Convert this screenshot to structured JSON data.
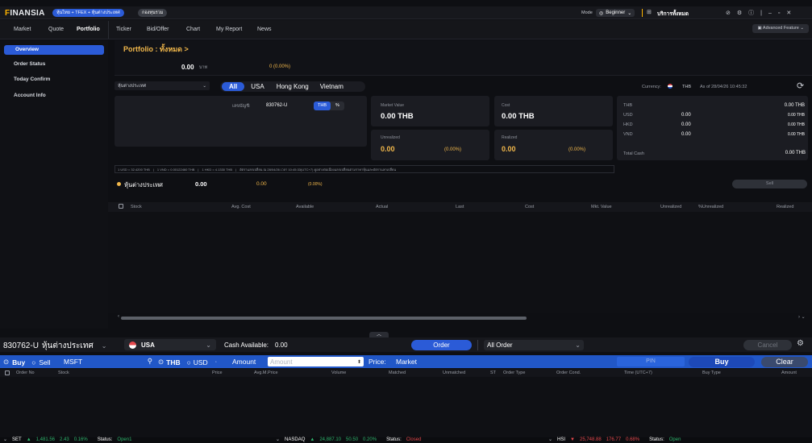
{
  "app": {
    "logo": "INANSIA",
    "logo_mark": "F",
    "tab1": "หุ้นไทย + TFEX + หุ้นต่างประเทศ",
    "tab2": "กองทุนรวม",
    "mode_label": "Mode",
    "mode_value": "Beginner",
    "services": "บริการทั้งหมด"
  },
  "menu": {
    "items": [
      "Market",
      "Quote",
      "Portfolio",
      "Ticker",
      "Bid/Offer",
      "Chart",
      "My Report",
      "News"
    ],
    "advanced": "Advanced Feature"
  },
  "sidebar": {
    "items": [
      "Overview",
      "Order Status",
      "Today Confirm",
      "Account Info"
    ]
  },
  "portfolio": {
    "title": "Portfolio : ทั้งหมด >",
    "value": "0.00",
    "unit": "บาท",
    "change": "0 (0.00%)"
  },
  "filter": {
    "dropdown": "หุ้นต่างประเทศ",
    "tabs": [
      "All",
      "USA",
      "Hong Kong",
      "Vietnam"
    ],
    "currency_label": "Currency:",
    "currency": "THB",
    "as_of": "As of 28/04/26 10:45:32"
  },
  "account": {
    "label": "เลขบัญชี:",
    "number": "830762-U",
    "toggle_thb": "THB",
    "toggle_pct": "%"
  },
  "summary": {
    "market_value_label": "Market Value",
    "market_value": "0.00 THB",
    "cost_label": "Cost",
    "cost": "0.00 THB",
    "unrealized_label": "Unrealized",
    "unrealized": "0.00",
    "unrealized_pct": "(0.00%)",
    "realized_label": "Realized",
    "realized": "0.00",
    "realized_pct": "(0.00%)"
  },
  "cash": {
    "rows": [
      {
        "cur": "THB",
        "amt": "",
        "thb": "0.00 THB"
      },
      {
        "cur": "USD",
        "amt": "0.00",
        "thb": "0.00 THB"
      },
      {
        "cur": "HKD",
        "amt": "0.00",
        "thb": "0.00 THB"
      },
      {
        "cur": "VND",
        "amt": "0.00",
        "thb": "0.00 THB"
      }
    ],
    "total_label": "Total Cash",
    "total": "0.00 THB"
  },
  "rates": {
    "r1": "1 USD = 32.4200 THB",
    "r2": "1 VND = 0.00122460 THB",
    "r3": "1 HKD = 4.1330 THB",
    "note": "อัตราแลกเปลี่ยน ณ 28/04/26 เวลา 10:45:33(UTC+7) ดูอย่างต่อเนื่องแลกเปลี่ยนตามราคาหุ้นและอัตราแลกเปลี่ยน"
  },
  "group": {
    "name": "หุ้นต่างประเทศ",
    "value": "0.00",
    "change": "0.00",
    "pct": "(0.00%)",
    "sell": "Sell"
  },
  "grid": {
    "headers": [
      "Stock",
      "Avg. Cost",
      "Available",
      "Actual",
      "Last",
      "Cost",
      "Mkt. Value",
      "Unrealized",
      "%Unrealized",
      "Realized"
    ]
  },
  "order": {
    "account": "830762-U",
    "account_type": "หุ้นต่างประเทศ",
    "market": "USA",
    "cash_label": "Cash Available:",
    "cash": "0.00",
    "order_btn": "Order",
    "filter": "All Order",
    "cancel": "Cancel",
    "buy": "Buy",
    "sell": "Sell",
    "symbol": "MSFT",
    "cur_thb": "THB",
    "cur_usd": "USD",
    "amount_label": "Amount",
    "amount_placeholder": "Amount",
    "price_label": "Price:",
    "price": "Market",
    "pin": "PIN",
    "buy_btn": "Buy",
    "clear_btn": "Clear",
    "headers": [
      "Order No",
      "Stock",
      "Price",
      "Avg.M.Price",
      "Volume",
      "Matched",
      "Unmatched",
      "ST",
      "Order Type",
      "Order Cond.",
      "Time (UTC+7)",
      "Buy Type",
      "Amount"
    ]
  },
  "ticker": {
    "set": {
      "name": "SET",
      "value": "1,481.56",
      "chg": "2.43",
      "pct": "0.16%",
      "status_label": "Status:",
      "status": "Open1"
    },
    "nasdaq": {
      "name": "NASDAQ",
      "value": "24,887.10",
      "chg": "50.50",
      "pct": "0.20%",
      "status_label": "Status:",
      "status": "Closed"
    },
    "hsi": {
      "name": "HSI",
      "value": "25,748.88",
      "chg": "176.77",
      "pct": "0.68%",
      "status_label": "Status:",
      "status": "Open"
    }
  },
  "colors": {
    "accent": "#2b5bd7",
    "up": "#2fb36d",
    "down": "#e5484d",
    "orange": "#f2b84b"
  }
}
